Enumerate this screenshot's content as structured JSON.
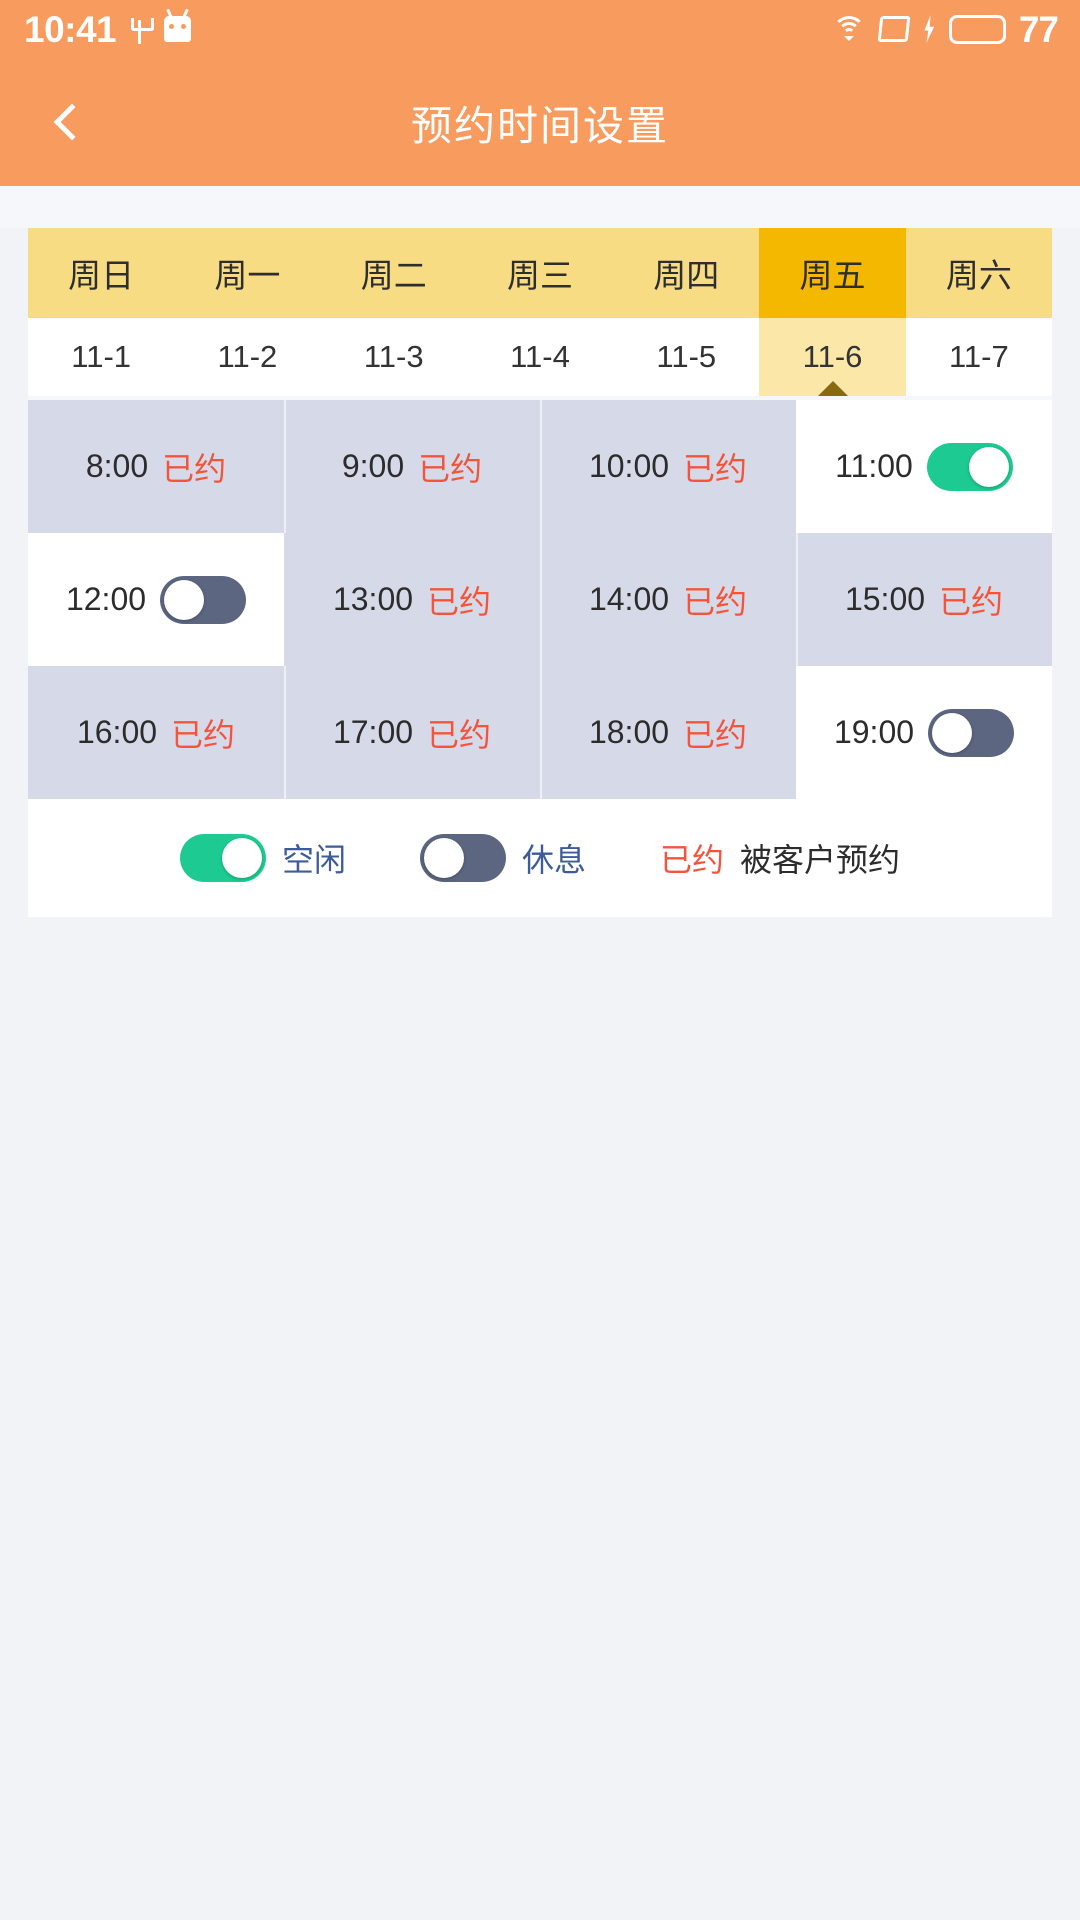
{
  "status_bar": {
    "time": "10:41",
    "battery_level": "77",
    "icons": [
      "usb-icon",
      "robot-icon",
      "wifi-icon",
      "sim-card-icon",
      "charging-bolt-icon",
      "battery-icon"
    ]
  },
  "app_bar": {
    "title": "预约时间设置",
    "back_icon": "chevron-left-icon"
  },
  "calendar": {
    "weekdays": [
      {
        "label": "周日",
        "selected": false
      },
      {
        "label": "周一",
        "selected": false
      },
      {
        "label": "周二",
        "selected": false
      },
      {
        "label": "周三",
        "selected": false
      },
      {
        "label": "周四",
        "selected": false
      },
      {
        "label": "周五",
        "selected": true
      },
      {
        "label": "周六",
        "selected": false
      }
    ],
    "dates": [
      {
        "label": "11-1",
        "selected": false
      },
      {
        "label": "11-2",
        "selected": false
      },
      {
        "label": "11-3",
        "selected": false
      },
      {
        "label": "11-4",
        "selected": false
      },
      {
        "label": "11-5",
        "selected": false
      },
      {
        "label": "11-6",
        "selected": true
      },
      {
        "label": "11-7",
        "selected": false
      }
    ]
  },
  "slots": [
    [
      {
        "time": "8:00",
        "state": "booked",
        "tag": "已约"
      },
      {
        "time": "9:00",
        "state": "booked",
        "tag": "已约"
      },
      {
        "time": "10:00",
        "state": "booked",
        "tag": "已约"
      },
      {
        "time": "11:00",
        "state": "free",
        "toggle": "on"
      }
    ],
    [
      {
        "time": "12:00",
        "state": "rest",
        "toggle": "off"
      },
      {
        "time": "13:00",
        "state": "booked",
        "tag": "已约"
      },
      {
        "time": "14:00",
        "state": "booked",
        "tag": "已约"
      },
      {
        "time": "15:00",
        "state": "booked",
        "tag": "已约"
      }
    ],
    [
      {
        "time": "16:00",
        "state": "booked",
        "tag": "已约"
      },
      {
        "time": "17:00",
        "state": "booked",
        "tag": "已约"
      },
      {
        "time": "18:00",
        "state": "booked",
        "tag": "已约"
      },
      {
        "time": "19:00",
        "state": "rest",
        "toggle": "off"
      }
    ]
  ],
  "legend": {
    "free_label": "空闲",
    "rest_label": "休息",
    "booked_tag": "已约",
    "booked_desc": "被客户预约"
  },
  "colors": {
    "header": "#F89B5F",
    "week_band": "#F8DC84",
    "week_selected": "#F5B800",
    "date_selected": "#FBE7A8",
    "pointer": "#8A6A10",
    "booked_bg": "#D6DAE8",
    "booked_text": "#F4543C",
    "toggle_on": "#1DCB92",
    "toggle_off": "#5C6680",
    "legend_text": "#3E5C9A",
    "page_bg": "#F2F3F7",
    "battery": "#14C414"
  }
}
